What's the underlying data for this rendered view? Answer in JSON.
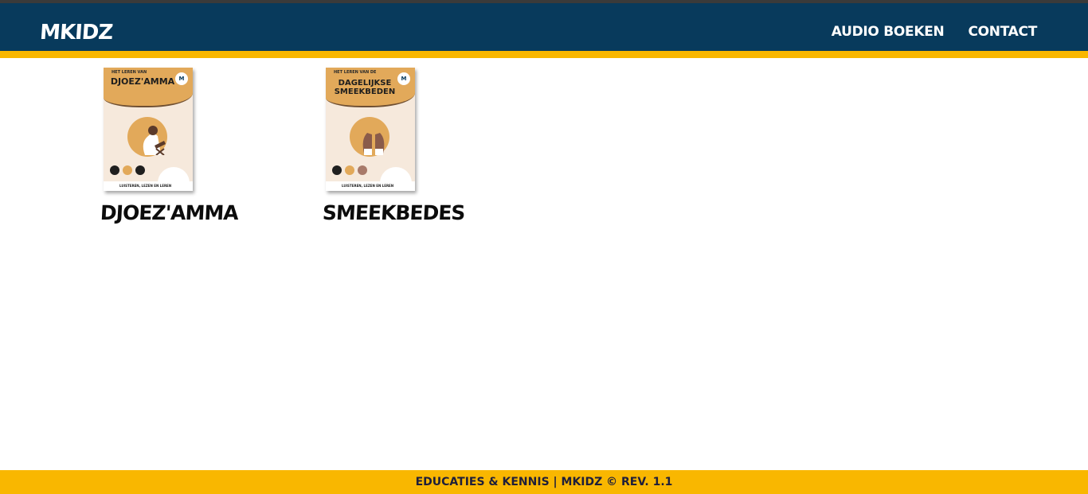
{
  "header": {
    "logo": "MKIDZ",
    "nav": [
      {
        "label": "AUDIO BOEKEN"
      },
      {
        "label": "CONTACT"
      }
    ]
  },
  "books": [
    {
      "title": "DJOEZ'AMMA",
      "cover": {
        "subtitle": "HET LEREN VAN",
        "title": "DJOEZ'AMMA",
        "logo": "M",
        "footer": "LUISTEREN, LEZEN EN LEREN"
      }
    },
    {
      "title": "SMEEKBEDES",
      "cover": {
        "subtitle": "HET LEREN VAN DE",
        "title": "DAGELIJKSE SMEEKBEDEN",
        "logo": "M",
        "footer": "LUISTEREN, LEZEN EN LEREN"
      }
    }
  ],
  "footer": {
    "text": "EDUCATIES & KENNIS | MKIDZ © REV. 1.1"
  },
  "colors": {
    "header": "#083a5c",
    "accent": "#f9b700",
    "cover_gold": "#e2a95a",
    "cover_bg": "#f6e9dc"
  }
}
